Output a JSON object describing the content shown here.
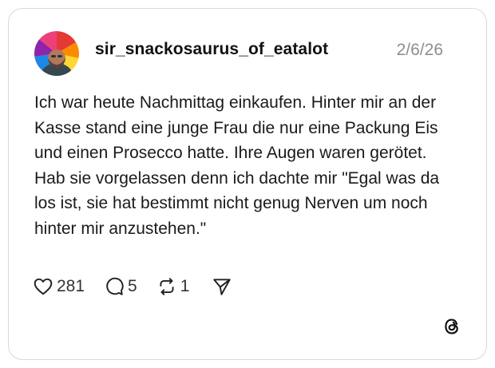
{
  "post": {
    "username": "sir_snackosaurus_of_eatalot",
    "date": "2/6/26",
    "text": "Ich war heute Nachmittag einkaufen. Hinter mir an der Kasse stand eine junge Frau die nur eine Packung Eis und einen Prosecco hatte. Ihre Augen waren gerötet. Hab sie vorgelassen denn ich dachte mir \"Egal was da los ist, sie hat bestimmt nicht genug Nerven um noch hinter mir anzustehen.\""
  },
  "actions": {
    "likes": "281",
    "replies": "5",
    "reposts": "1"
  },
  "icons": {
    "like": "heart-icon",
    "reply": "comment-bubble-icon",
    "repost": "repost-arrows-icon",
    "share": "send-paper-plane-icon",
    "brand": "threads-logo-icon"
  },
  "colors": {
    "text": "#1a1a1a",
    "muted": "#8e8e8e",
    "border": "#d9d9d9"
  }
}
